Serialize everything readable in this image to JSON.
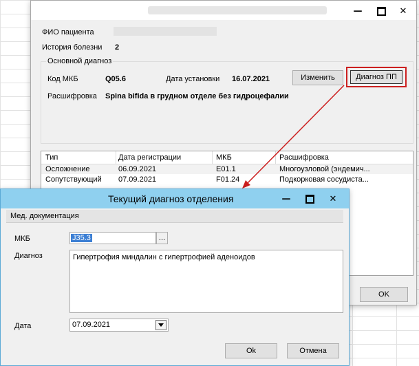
{
  "background_window": {
    "title": "",
    "patient_name_label": "ФИО пациента",
    "history_label": "История болезни",
    "history_value": "2",
    "group_label": "Основной диагноз",
    "icd_label": "Код МКБ",
    "icd_value": "Q05.6",
    "date_label": "Дата установки",
    "date_value": "16.07.2021",
    "change_button": "Изменить",
    "pp_button": "Диагноз ПП",
    "decode_label": "Расшифровка",
    "decode_value": "Spina bifida в грудном отделе без гидроцефалии",
    "table": {
      "headers": [
        "Тип",
        "Дата регистрации",
        "МКБ",
        "Расшифровка"
      ],
      "rows": [
        [
          "Осложнение",
          "06.09.2021",
          "E01.1",
          "Многоузловой (эндемич..."
        ],
        [
          "Сопутствующий",
          "07.09.2021",
          "F01.24",
          "Подкорковая сосудиста..."
        ]
      ]
    },
    "ok_button": "OK"
  },
  "dialog": {
    "title": "Текущий диагноз отделения",
    "tab_label": "Мед. документация",
    "mkb_label": "МКБ",
    "mkb_value": "J35.3",
    "browse_button": "...",
    "diagnosis_label": "Диагноз",
    "diagnosis_value": "Гипертрофия миндалин с гипертрофией аденоидов",
    "date_label": "Дата",
    "date_value": "07.09.2021",
    "ok_button": "Ok",
    "cancel_button": "Отмена"
  },
  "colors": {
    "dialog_title_bar": "#8fd0ef",
    "annotation_red": "#cc1f1f",
    "selection": "#3c7fd4"
  },
  "icons": [
    "minimize-icon",
    "maximize-icon",
    "close-icon",
    "chevron-down-icon"
  ]
}
